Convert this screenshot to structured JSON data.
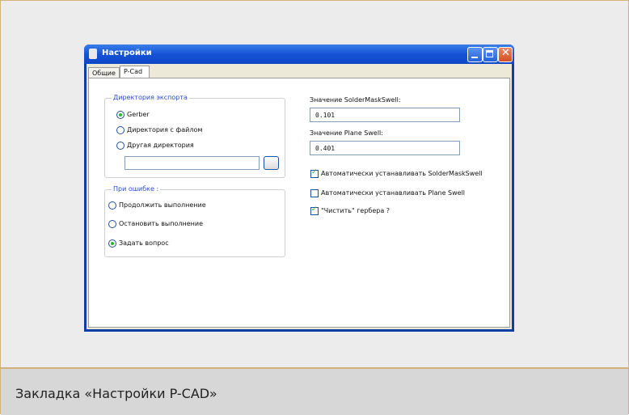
{
  "window": {
    "title": "Настройки",
    "tabs": [
      {
        "label": "Общие",
        "active": false
      },
      {
        "label": "P-Cad",
        "active": true
      }
    ]
  },
  "export_dir": {
    "legend": "Директория экспорта",
    "options": [
      "Gerber",
      "Директория с файлом",
      "Другая директория"
    ],
    "selected": "Gerber",
    "path_value": "",
    "browse_label": ""
  },
  "on_error": {
    "legend": "При ошибке :",
    "options": [
      "Продолжить выполнение",
      "Остановить выполнение",
      "Задать вопрос"
    ],
    "selected": "Задать вопрос"
  },
  "solder_mask": {
    "label": "Значение SolderMaskSwell:",
    "value": "0.101"
  },
  "plane_swell": {
    "label": "Значение Plane Swell:",
    "value": "0.401"
  },
  "checks": [
    {
      "label": "Автоматически устанавливать SolderMaskSwell",
      "checked": true
    },
    {
      "label": "Автоматически устанавливать Plane Swell",
      "checked": false
    },
    {
      "label": "\"Чистить\" гербера ?",
      "checked": true
    }
  ],
  "caption": "Закладка «Настройки P-CAD»",
  "colors": {
    "title_bar": "#1553d6",
    "radio_dot": "#2fb22f",
    "legend_text": "#2a4bd0",
    "frame_border": "#d2b27a"
  },
  "icons": {
    "minimize": "minimize-icon",
    "maximize": "maximize-icon",
    "close": "close-icon",
    "app": "app-icon"
  }
}
